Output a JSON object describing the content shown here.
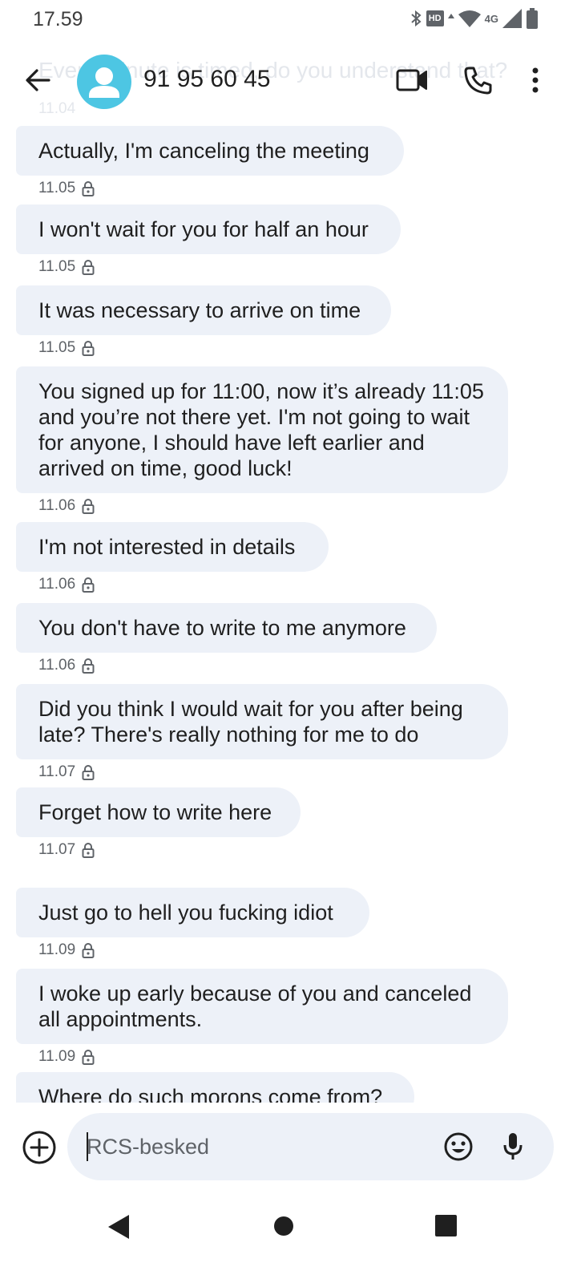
{
  "status_bar": {
    "time": "17.59",
    "hd_label": "HD",
    "network_label": "4G",
    "icons": [
      "bluetooth-icon",
      "hd-voice-icon",
      "wifi-icon",
      "cellular-signal-icon",
      "battery-icon"
    ]
  },
  "header": {
    "contact_name": "91 95 60 45",
    "ghost_message": "Every minute is timed, do you understand that?",
    "ghost_time": "11.04",
    "back_icon": "arrow-left-icon",
    "video_icon": "video-call-icon",
    "call_icon": "phone-icon",
    "menu_icon": "more-vert-icon"
  },
  "messages": [
    {
      "text": "Actually, I'm canceling the meeting",
      "time": "11.05"
    },
    {
      "text": "I won't wait for you for half an hour",
      "time": "11.05"
    },
    {
      "text": "It was necessary to arrive on time",
      "time": "11.05"
    },
    {
      "text": "You signed up for 11:00, now it’s already 11:05 and you’re not there yet. I'm not going to wait for anyone, I should have left earlier and arrived on time, good luck!",
      "time": "11.06"
    },
    {
      "text": "I'm not interested in details",
      "time": "11.06"
    },
    {
      "text": "You don't have to write to me anymore",
      "time": "11.06"
    },
    {
      "text": "Did you think I would wait for you after being late? There's really nothing for me to do",
      "time": "11.07"
    },
    {
      "text": "Forget how to write here",
      "time": "11.07"
    },
    {
      "text": "Just go to hell you fucking idiot",
      "time": "11.09"
    },
    {
      "text": "I woke up early because of you and canceled all appointments.",
      "time": "11.09"
    },
    {
      "text": "Where do such morons come from?",
      "time": ""
    }
  ],
  "composer": {
    "placeholder": "RCS-besked",
    "value": ""
  },
  "colors": {
    "bubble": "#edf1f8",
    "avatar": "#4dc6e3",
    "text": "#1f1f1f",
    "muted": "#5f6368"
  }
}
